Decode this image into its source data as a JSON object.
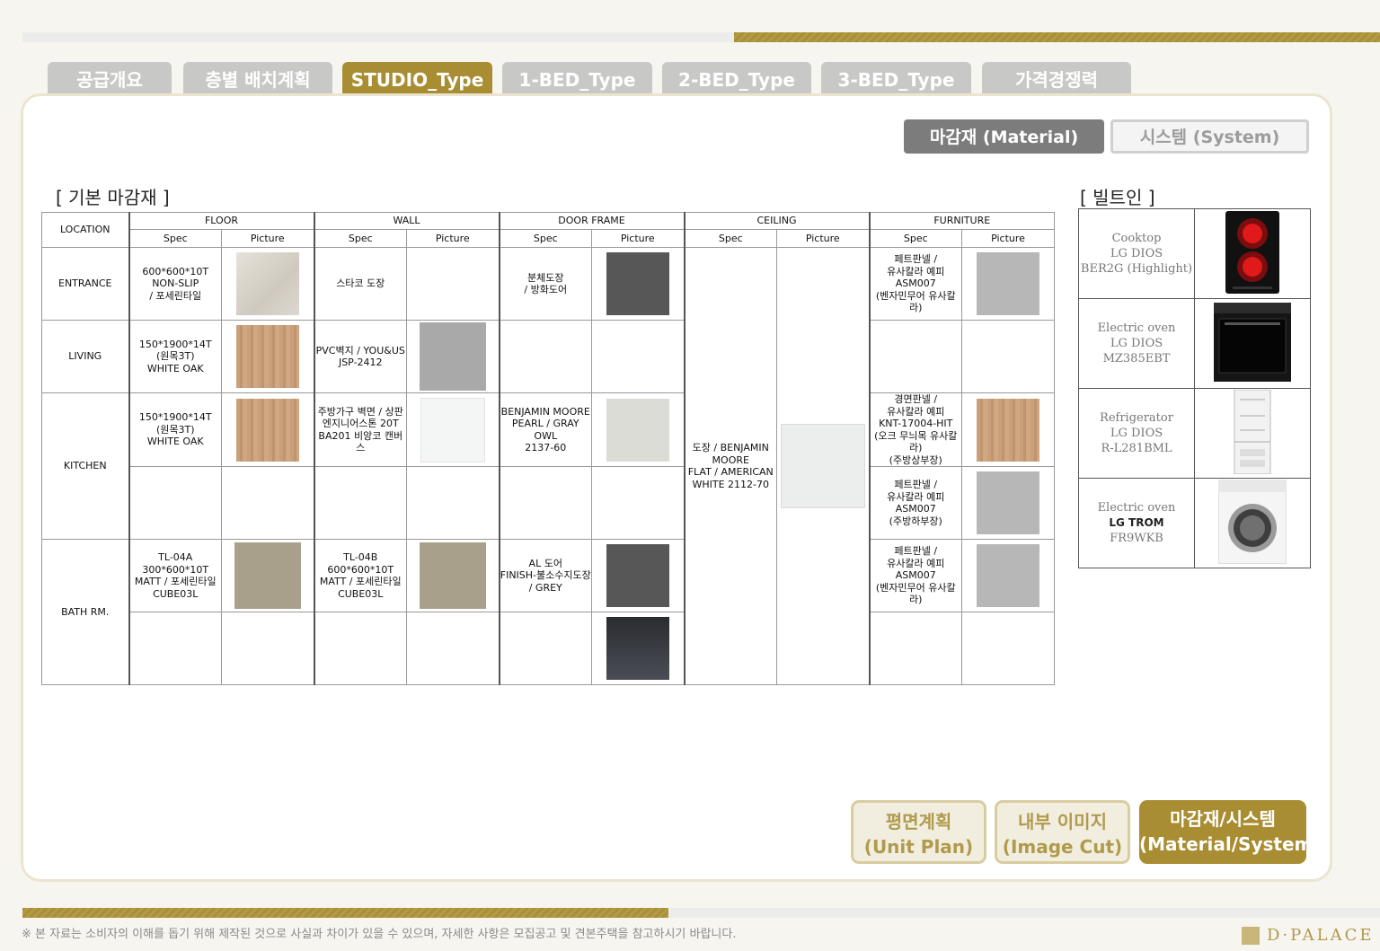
{
  "tabs": [
    {
      "label": "공급개요",
      "active": false
    },
    {
      "label": "층별 배치계획",
      "active": false
    },
    {
      "label": "STUDIO_Type",
      "active": true
    },
    {
      "label": "1-BED_Type",
      "active": false
    },
    {
      "label": "2-BED_Type",
      "active": false
    },
    {
      "label": "3-BED_Type",
      "active": false
    },
    {
      "label": "가격경쟁력",
      "active": false
    }
  ],
  "toggles": {
    "material": "마감재 (Material)",
    "system": "시스템 (System)"
  },
  "section_titles": {
    "basic": "[ 기본 마감재 ]",
    "builtin": "[ 빌트인 ]"
  },
  "table": {
    "location": "LOCATION",
    "groups": [
      "FLOOR",
      "WALL",
      "DOOR FRAME",
      "CEILING",
      "FURNITURE"
    ],
    "spec": "Spec",
    "picture": "Picture",
    "rows": {
      "entrance": "ENTRANCE",
      "living": "LIVING",
      "kitchen": "KITCHEN",
      "bath": "BATH RM."
    },
    "cells": {
      "entrance_floor": "600*600*10T\nNON-SLIP\n/ 포세린타일",
      "entrance_wall": "스타코 도장",
      "entrance_door": "분체도장\n/ 방화도어",
      "entrance_furn": "페트판넬 /\n유사칼라 예피\nASM007\n(벤자민무어 유사칼라)",
      "living_floor": "150*1900*14T\n(원목3T)\nWHITE OAK",
      "living_wall": "PVC벽지 / YOU&US\nJSP-2412",
      "kitchen_floor": "150*1900*14T\n(원목3T)\nWHITE OAK",
      "kitchen_wall": "주방가구 벽면 / 상판\n엔지니어스톤 20T\nBA201 비앙코 캔버스",
      "kitchen_door": "BENJAMIN MOORE\nPEARL / GRAY OWL\n2137-60",
      "ceiling": "도장 / BENJAMIN\nMOORE\nFLAT / AMERICAN\nWHITE 2112-70",
      "kitchen_furn1": "경면판넬 /\n유사칼라 예피\nKNT-17004-HIT\n(오크 무늬목 유사칼라)\n(주방상부장)",
      "kitchen_furn2": "페트판넬 /\n유사칼라 예피\nASM007\n(주방하부장)",
      "bath_floor": "TL-04A\n300*600*10T\nMATT / 포세린타일\nCUBE03L",
      "bath_wall": "TL-04B\n600*600*10T\nMATT / 포세린타일\nCUBE03L",
      "bath_door": "AL 도어\nFINISH-불소수지도장\n/ GREY",
      "bath_furn": "페트판넬 /\n유사칼라 예피\nASM007\n(벤자민무어 유사칼라)"
    }
  },
  "builtin": [
    {
      "name": "Cooktop",
      "brand": "LG DIOS",
      "model": "BER2G (Highlight)"
    },
    {
      "name": "Electric oven",
      "brand": "LG DIOS",
      "model": "MZ385EBT"
    },
    {
      "name": "Refrigerator",
      "brand": "LG DIOS",
      "model": "R-L281BML"
    },
    {
      "name": "Electric oven",
      "brand": "LG TROM",
      "model": "FR9WKB"
    }
  ],
  "buttons": {
    "unit_plan": [
      "평면계획",
      "(Unit Plan)"
    ],
    "image_cut": [
      "내부 이미지",
      "(Image Cut)"
    ],
    "material": [
      "마감재/시스템",
      "(Material/System)"
    ]
  },
  "footnote": "※ 본 자료는 소비자의 이해를 돕기 위해 제작된 것으로 사실과 차이가 있을 수 있으며, 자세한 사항은 모집공고 및 견본주택을 참고하시기 바랍니다.",
  "logo": "D·PALACE",
  "colors": {
    "gold": "#a98d32",
    "tab_gray": "#c8c8c6",
    "toggle_gray": "#7c7c7c"
  },
  "swatches": {
    "marble": "#ddd8d0",
    "oak": "#c9a07a",
    "darkgray": "#575757",
    "lightgray": "#b7b7b7",
    "wallpaper": "#a9a9a9",
    "white": "#f4f5f5",
    "pearl": "#dcdcd6",
    "stone": "#a8a08a",
    "navy": "#2f3238",
    "ceiling": "#eceeee"
  }
}
